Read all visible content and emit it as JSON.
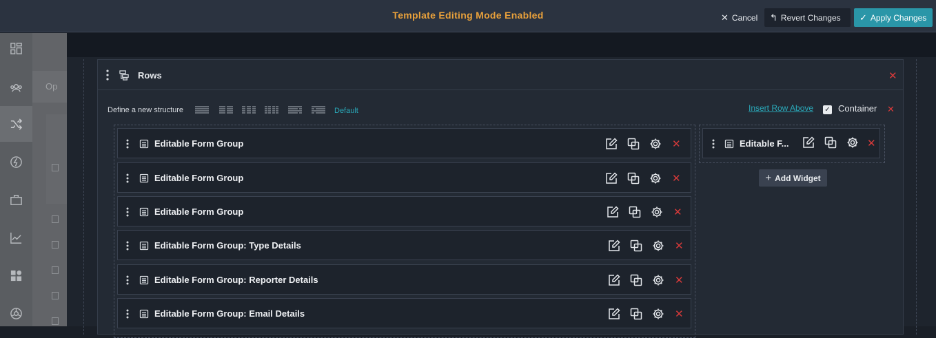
{
  "topbar": {
    "title": "Template Editing Mode Enabled",
    "cancel_label": "Cancel",
    "revert_label": "Revert Changes",
    "apply_label": "Apply Changes"
  },
  "backpanel": {
    "partial_text": "Op"
  },
  "rows_panel": {
    "title": "Rows",
    "structure_label": "Define a new structure",
    "default_label": "Default",
    "insert_row_above": "Insert Row Above",
    "container_label": "Container",
    "container_checked": "✓"
  },
  "left_widgets": [
    {
      "label": "Editable Form Group"
    },
    {
      "label": "Editable Form Group"
    },
    {
      "label": "Editable Form Group"
    },
    {
      "label": "Editable Form Group: Type Details"
    },
    {
      "label": "Editable Form Group: Reporter Details"
    },
    {
      "label": "Editable Form Group: Email Details"
    }
  ],
  "right_widget": {
    "label": "Editable F..."
  },
  "add_widget_label": "Add Widget",
  "colors": {
    "accent": "#2a96a8",
    "title": "#e9a13b",
    "danger": "#d83a3a"
  }
}
